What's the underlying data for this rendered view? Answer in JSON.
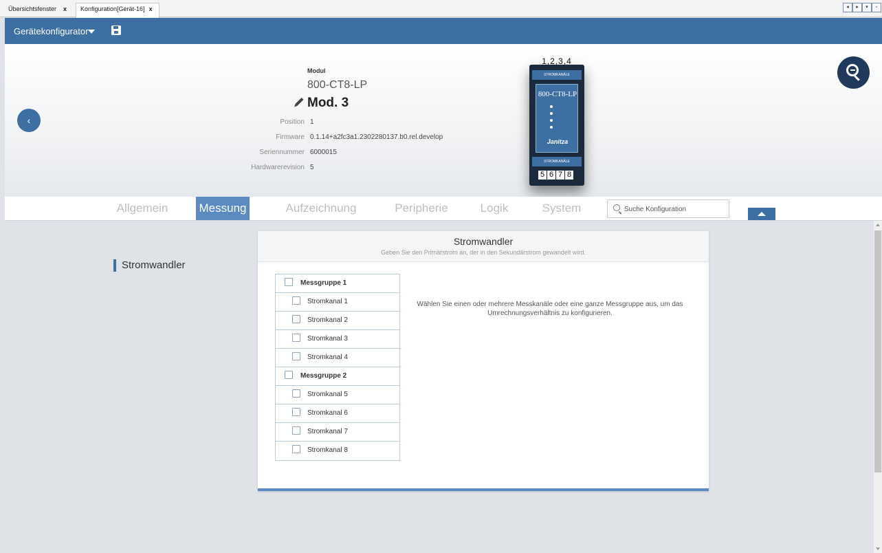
{
  "tabs": [
    {
      "label": "Übersichtsfenster",
      "close": "x"
    },
    {
      "label": "Konfiguration[Gerät-16]",
      "close": "x"
    }
  ],
  "toolbar": {
    "title": "Gerätekonfigurator",
    "icons": [
      "caret-down-icon",
      "save-icon"
    ]
  },
  "module": {
    "label": "Modul",
    "type": "800-CT8-LP",
    "name": "Mod. 3",
    "info": [
      {
        "label": "Position",
        "value": "1"
      },
      {
        "label": "Firmware",
        "value": "0.1.14+a2fc3a1.2302280137.b0.rel.develop"
      },
      {
        "label": "Seriennummer",
        "value": "6000015"
      },
      {
        "label": "Hardwarerevision",
        "value": "5"
      }
    ]
  },
  "device": {
    "top_numbers": "1,2,3,4",
    "band_label": "STROMKANÄLE",
    "model": "800-CT8-LP",
    "brand": "Janitza",
    "bottom_numbers": [
      "5",
      "6",
      "7",
      "8"
    ]
  },
  "nav": {
    "items": [
      "Allgemein",
      "Messung",
      "Aufzeichnung",
      "Peripherie",
      "Logik",
      "System"
    ],
    "active": "Messung",
    "search_placeholder": "Suche Konfiguration"
  },
  "sidebar": {
    "heading": "Stromwandler"
  },
  "panel": {
    "title": "Stromwandler",
    "subtitle": "Geben Sie den Primärstrom an, der in den Sekundärstrom gewandelt wird.",
    "rows": [
      {
        "type": "group",
        "label": "Messgruppe 1"
      },
      {
        "type": "channel",
        "label": "Stromkanal 1"
      },
      {
        "type": "channel",
        "label": "Stromkanal 2"
      },
      {
        "type": "channel",
        "label": "Stromkanal 3"
      },
      {
        "type": "channel",
        "label": "Stromkanal 4"
      },
      {
        "type": "group",
        "label": "Messgruppe 2"
      },
      {
        "type": "channel",
        "label": "Stromkanal 5"
      },
      {
        "type": "channel",
        "label": "Stromkanal 6"
      },
      {
        "type": "channel",
        "label": "Stromkanal 7"
      },
      {
        "type": "channel",
        "label": "Stromkanal 8"
      }
    ],
    "message": "Wählen Sie einen oder mehrere Messkanäle oder eine ganze Messgruppe aus, um das Umrechnungsverhältnis zu konfigurieren."
  },
  "colors": {
    "primary": "#3e6fa2",
    "active_tab": "#5b8bc0",
    "dark_button": "#1f3a5c",
    "background": "#dfe3e8"
  }
}
